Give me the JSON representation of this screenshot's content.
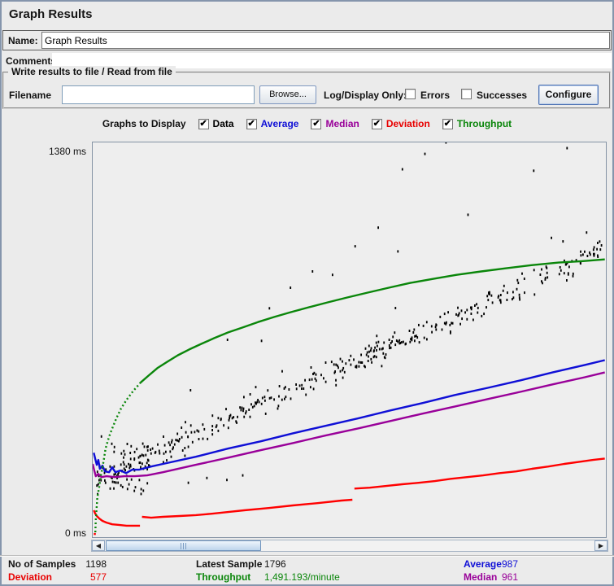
{
  "window": {
    "title": "Graph Results"
  },
  "name_row": {
    "label": "Name:",
    "value": "Graph Results"
  },
  "comments_row": {
    "label": "Comments:",
    "value": ""
  },
  "file_group": {
    "title": "Write results to file / Read from file",
    "filename_label": "Filename",
    "filename_value": "",
    "browse_label": "Browse...",
    "log_display_label": "Log/Display Only:",
    "errors_label": "Errors",
    "errors_checked": false,
    "successes_label": "Successes",
    "successes_checked": false,
    "configure_label": "Configure"
  },
  "graphs_to_display": {
    "label": "Graphs to Display",
    "options": [
      {
        "label": "Data",
        "color": "#000000",
        "checked": true
      },
      {
        "label": "Average",
        "color": "#0f0fd6",
        "checked": true
      },
      {
        "label": "Median",
        "color": "#990099",
        "checked": true
      },
      {
        "label": "Deviation",
        "color": "#e80000",
        "checked": true
      },
      {
        "label": "Throughput",
        "color": "#0a860a",
        "checked": true
      }
    ]
  },
  "axis": {
    "top_label": "1380 ms",
    "bottom_label": "0 ms"
  },
  "scrollbar": {
    "left_arrow": "◀",
    "right_arrow": "▶"
  },
  "stats": {
    "no_of_samples": {
      "label": "No of Samples",
      "value": "1198",
      "color": "#000000"
    },
    "latest_sample": {
      "label": "Latest Sample",
      "value": "1796",
      "color": "#000000"
    },
    "average": {
      "label": "Average",
      "value": "987",
      "color": "#0f0fd6"
    },
    "deviation": {
      "label": "Deviation",
      "value": "577",
      "color": "#e80000"
    },
    "throughput": {
      "label": "Throughput",
      "value": "1,491.193/minute",
      "color": "#0a860a"
    },
    "median": {
      "label": "Median",
      "value": "961",
      "color": "#990099"
    }
  },
  "chart_data": {
    "type": "scatter",
    "title": "Graph Results (JMeter response-time graph, scrolled view of first ~400 of 1198 samples)",
    "ylabel": "ms",
    "ylim": [
      0,
      1380
    ],
    "xlim_pct": [
      0,
      100
    ],
    "grid": false,
    "legend_position": "top (Graphs to Display checkboxes)",
    "note": "x values are percent of the visible plot width; y values read off the 0-1380 ms axis. Throughput line is plotted by JMeter on its own hidden scale (latest value 1,491.193/minute).",
    "series": [
      {
        "name": "Data",
        "type": "scatter",
        "color": "#000000",
        "seed": 7,
        "band": {
          "count": 400,
          "x_range": [
            1,
            99.5
          ],
          "trend": [
            [
              1,
              205
            ],
            [
              100,
              1010
            ]
          ],
          "sigma_ms": 22,
          "stray_up_prob": 0.045,
          "stray_up_ms": [
            60,
            320
          ]
        },
        "start_cluster": {
          "count": 60,
          "x_range": [
            0.3,
            11
          ],
          "ms_range": [
            150,
            330
          ]
        },
        "outliers": [
          [
            68.7,
            1380
          ],
          [
            64.6,
            1340
          ],
          [
            92.3,
            1360
          ],
          [
            60.2,
            1286
          ],
          [
            85.8,
            1281
          ],
          [
            73.0,
            1127
          ],
          [
            55.5,
            1082
          ],
          [
            96.1,
            1065
          ],
          [
            91.5,
            1034
          ],
          [
            51.0,
            1017
          ],
          [
            42.7,
            929
          ],
          [
            46.6,
            917
          ],
          [
            38.4,
            872
          ],
          [
            34.3,
            800
          ]
        ],
        "low_strays": [
          [
            22.1,
            207
          ],
          [
            29.1,
            216
          ],
          [
            18.5,
            190
          ],
          [
            26.0,
            200
          ]
        ]
      },
      {
        "name": "Average",
        "type": "line",
        "color": "#0f0fd6",
        "segments": [
          {
            "dashed": false,
            "points": [
              [
                0.2,
                295
              ],
              [
                0.5,
                273
              ],
              [
                0.8,
                253
              ],
              [
                1.1,
                270
              ],
              [
                1.4,
                239
              ],
              [
                1.9,
                250
              ],
              [
                2.4,
                230
              ],
              [
                3.2,
                227
              ],
              [
                3.8,
                244
              ],
              [
                4.4,
                227
              ],
              [
                5.4,
                233
              ],
              [
                6.5,
                224
              ],
              [
                7.7,
                236
              ],
              [
                9,
                236
              ],
              [
                11.4,
                247
              ],
              [
                13.7,
                256
              ],
              [
                20.1,
                281
              ],
              [
                26.4,
                310
              ],
              [
                32.7,
                335
              ],
              [
                39,
                363
              ],
              [
                45.3,
                389
              ],
              [
                51.7,
                415
              ],
              [
                58,
                443
              ],
              [
                64.3,
                469
              ],
              [
                70.6,
                497
              ],
              [
                77,
                522
              ],
              [
                83.3,
                548
              ],
              [
                89.6,
                576
              ],
              [
                95.9,
                602
              ],
              [
                99.8,
                619
              ]
            ]
          }
        ]
      },
      {
        "name": "Median",
        "type": "line",
        "color": "#990099",
        "segments": [
          {
            "dashed": false,
            "points": [
              [
                0,
                256
              ],
              [
                0.3,
                233
              ],
              [
                0.6,
                213
              ],
              [
                1.1,
                221
              ],
              [
                1.7,
                210
              ],
              [
                2.7,
                213
              ],
              [
                4.3,
                210
              ],
              [
                6.2,
                213
              ],
              [
                8.2,
                213
              ],
              [
                10.6,
                216
              ],
              [
                13.7,
                227
              ],
              [
                20.1,
                253
              ],
              [
                26.4,
                278
              ],
              [
                32.7,
                304
              ],
              [
                39,
                329
              ],
              [
                45.3,
                355
              ],
              [
                51.7,
                380
              ],
              [
                58,
                406
              ],
              [
                64.3,
                432
              ],
              [
                70.6,
                457
              ],
              [
                77,
                483
              ],
              [
                83.3,
                508
              ],
              [
                89.6,
                534
              ],
              [
                95.9,
                559
              ],
              [
                99.8,
                576
              ]
            ]
          }
        ]
      },
      {
        "name": "Deviation",
        "type": "line",
        "color": "#ff0000",
        "segments": [
          {
            "dashed": false,
            "points": [
              [
                0.2,
                11
              ],
              [
                0.6,
                11
              ]
            ]
          },
          {
            "dashed": false,
            "points": [
              [
                0.2,
                94
              ],
              [
                0.5,
                82
              ],
              [
                0.8,
                74
              ],
              [
                1.3,
                65
              ],
              [
                1.9,
                57
              ],
              [
                2.7,
                51
              ],
              [
                3.8,
                45
              ],
              [
                5.1,
                43
              ],
              [
                6.6,
                40
              ],
              [
                8.1,
                40
              ],
              [
                9.2,
                40
              ]
            ]
          },
          {
            "dashed": false,
            "points": [
              [
                9.6,
                71
              ],
              [
                11.4,
                68
              ],
              [
                13.7,
                71
              ],
              [
                16.9,
                74
              ],
              [
                20.1,
                77
              ],
              [
                23.2,
                82
              ],
              [
                26.4,
                88
              ],
              [
                29.5,
                94
              ],
              [
                34.3,
                102
              ],
              [
                39,
                111
              ],
              [
                43.8,
                119
              ],
              [
                48.5,
                128
              ],
              [
                50.6,
                131
              ]
            ]
          },
          {
            "dashed": false,
            "points": [
              [
                51,
                170
              ],
              [
                54,
                173
              ],
              [
                57.2,
                179
              ],
              [
                60.3,
                185
              ],
              [
                63.5,
                190
              ],
              [
                66.7,
                196
              ],
              [
                69.8,
                204
              ],
              [
                73,
                210
              ],
              [
                76.1,
                216
              ],
              [
                79.3,
                224
              ],
              [
                82.5,
                230
              ],
              [
                85.6,
                239
              ],
              [
                88.8,
                247
              ],
              [
                91.9,
                256
              ],
              [
                95.1,
                264
              ],
              [
                97.5,
                270
              ],
              [
                99.8,
                275
              ]
            ]
          }
        ]
      },
      {
        "name": "Throughput",
        "type": "line",
        "color": "#0a860a",
        "segments": [
          {
            "dashed": true,
            "points": [
              [
                0.5,
                17
              ],
              [
                0.6,
                60
              ],
              [
                0.9,
                139
              ],
              [
                1.3,
                179
              ],
              [
                1.6,
                216
              ],
              [
                2.1,
                264
              ],
              [
                2.5,
                310
              ],
              [
                3.2,
                352
              ],
              [
                3.8,
                380
              ],
              [
                4.6,
                415
              ],
              [
                5.5,
                449
              ],
              [
                6.6,
                480
              ],
              [
                7.9,
                511
              ],
              [
                9.3,
                540
              ]
            ]
          },
          {
            "dashed": false,
            "points": [
              [
                9.3,
                540
              ],
              [
                10.9,
                565
              ],
              [
                12.6,
                591
              ],
              [
                14.5,
                613
              ],
              [
                16.6,
                636
              ],
              [
                18.8,
                656
              ],
              [
                21.2,
                676
              ],
              [
                23.7,
                696
              ],
              [
                26.4,
                716
              ],
              [
                29.2,
                733
              ],
              [
                32.2,
                752
              ],
              [
                35.4,
                770
              ],
              [
                38.7,
                787
              ],
              [
                42.2,
                804
              ],
              [
                45.8,
                821
              ],
              [
                49.6,
                838
              ],
              [
                53.6,
                855
              ],
              [
                57.7,
                872
              ],
              [
                61.9,
                889
              ],
              [
                66.4,
                903
              ],
              [
                70.9,
                917
              ],
              [
                75.7,
                929
              ],
              [
                80.6,
                940
              ],
              [
                85.5,
                951
              ],
              [
                90.8,
                960
              ],
              [
                95.3,
                965
              ],
              [
                99.8,
                971
              ]
            ]
          }
        ]
      }
    ]
  }
}
